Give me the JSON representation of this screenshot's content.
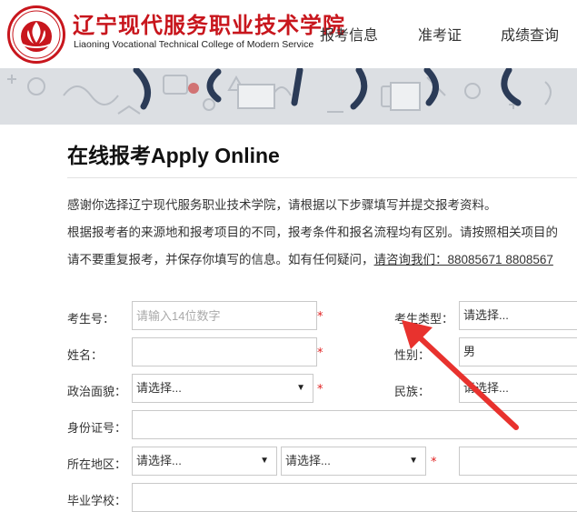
{
  "header": {
    "school_name_cn": "辽宁现代服务职业技术学院",
    "school_name_en": "Liaoning Vocational Technical College of Modern Service",
    "nav": [
      "报考信息",
      "准考证",
      "成绩查询"
    ]
  },
  "page": {
    "title": "在线报考Apply Online",
    "intro_line1": "感谢你选择辽宁现代服务职业技术学院，请根据以下步骤填写并提交报考资料。",
    "intro_line2": "根据报考者的来源地和报考项目的不同，报考条件和报名流程均有区别。请按照相关项目的",
    "intro_line3_text": "请不要重复报考，并保存你填写的信息。如有任何疑问，",
    "intro_line3_link": "请咨询我们：88085671 8808567"
  },
  "form": {
    "exam_no_label": "考生号：",
    "exam_no_placeholder": "请输入14位数字",
    "exam_type_label": "考生类型：",
    "exam_type_value": "请选择...",
    "name_label": "姓名：",
    "gender_label": "性别：",
    "gender_value": "男",
    "political_label": "政治面貌：",
    "political_value": "请选择...",
    "ethnicity_label": "民族：",
    "ethnicity_value": "请选择...",
    "id_label": "身份证号：",
    "region_label": "所在地区：",
    "region_province": "请选择...",
    "region_city": "请选择...",
    "school_label": "毕业学校：",
    "required_mark": "*",
    "caret": "▼"
  },
  "colors": {
    "brand_red": "#c8161d",
    "arrow_red": "#e8322e",
    "required": "#e02020"
  }
}
